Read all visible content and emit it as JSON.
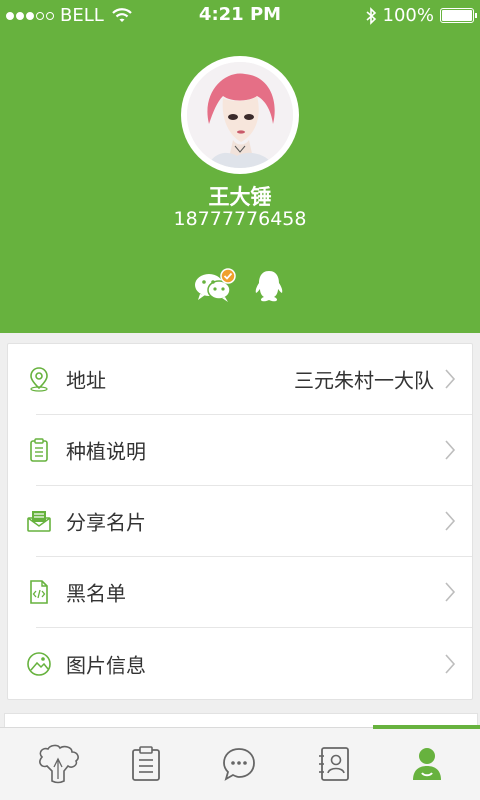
{
  "status_bar": {
    "carrier": "BELL",
    "time": "4:21 PM",
    "battery": "100%"
  },
  "profile": {
    "name": "王大锤",
    "phone": "18777776458"
  },
  "menu": [
    {
      "label": "地址",
      "value": "三元朱村一大队",
      "icon": "location-pin-icon"
    },
    {
      "label": "种植说明",
      "value": "",
      "icon": "clipboard-icon"
    },
    {
      "label": "分享名片",
      "value": "",
      "icon": "envelope-card-icon"
    },
    {
      "label": "黑名单",
      "value": "",
      "icon": "code-file-icon"
    },
    {
      "label": "图片信息",
      "value": "",
      "icon": "image-icon"
    }
  ],
  "tabs": [
    {
      "icon": "vegetable-icon",
      "active": false
    },
    {
      "icon": "notes-icon",
      "active": false
    },
    {
      "icon": "chat-bubble-icon",
      "active": false
    },
    {
      "icon": "contacts-icon",
      "active": false
    },
    {
      "icon": "profile-icon",
      "active": true
    }
  ],
  "colors": {
    "brand_green": "#67b23e",
    "badge_orange": "#f0a02c",
    "icon_gray": "#666666"
  }
}
